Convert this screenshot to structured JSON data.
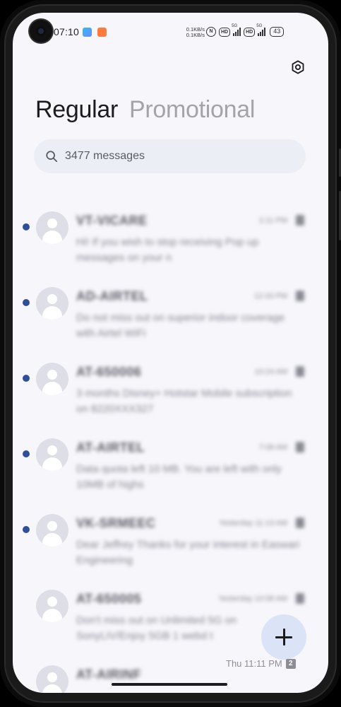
{
  "status_bar": {
    "time": "07:10",
    "net_speed_up": "0.1KB/s",
    "net_speed_down": "0.1KB/s",
    "hd1": "HD",
    "sig1": "5G",
    "hd2": "HD",
    "sig2": "5G",
    "battery": "43"
  },
  "tabs": [
    {
      "label": "Regular",
      "active": true
    },
    {
      "label": "Promotional",
      "active": false
    }
  ],
  "search": {
    "placeholder": "3477 messages"
  },
  "messages": [
    {
      "sender": "VT-VICARE",
      "time": "2:11 PM",
      "preview": "Hi! If you wish to stop receiving Pop up messages on your n",
      "unread": true
    },
    {
      "sender": "AD-AIRTEL",
      "time": "12:33 PM",
      "preview": "Do not miss out on superior indoor coverage with Airtel WiFi",
      "unread": true
    },
    {
      "sender": "AT-650006",
      "time": "10:24 AM",
      "preview": "3 months Disney+ Hotstar Mobile subscription on 8220XXX327",
      "unread": true
    },
    {
      "sender": "AT-AIRTEL",
      "time": "7:08 AM",
      "preview": "Data quota left 10 MB. You are left with only 10MB of highs",
      "unread": true
    },
    {
      "sender": "VK-SRMEEC",
      "time": "Yesterday 11:13 AM",
      "preview": "Dear Jeffrey Thanks for your interest in Easwari Engineering",
      "unread": true
    },
    {
      "sender": "AT-650005",
      "time": "Yesterday 10:08 AM",
      "preview": "Don't miss out on Unlimited 5G on SonyLIV/Enjoy 5GB 1 webd t",
      "unread": false
    },
    {
      "sender": "AT-AIRINF",
      "time": "",
      "preview": "",
      "unread": false
    }
  ],
  "bottom_overlay": {
    "time": "Thu 11:11 PM",
    "sim": "2"
  },
  "icons": {
    "settings": "gear-icon",
    "search": "search-icon",
    "compose": "plus-icon"
  },
  "colors": {
    "background": "#f7f7fb",
    "unread_dot": "#2f4f9a",
    "fab": "#dbe3f6",
    "search_bg": "#eceef6"
  }
}
